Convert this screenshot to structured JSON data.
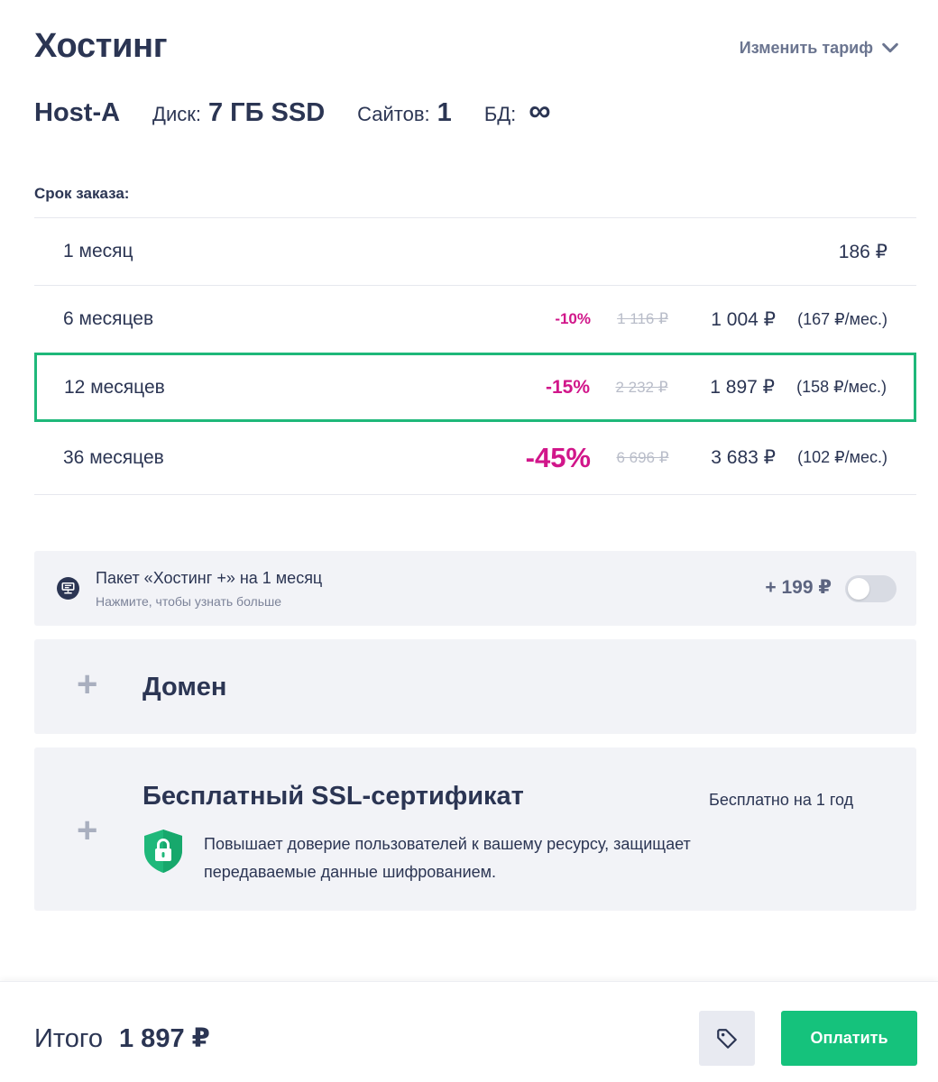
{
  "header": {
    "title": "Хостинг",
    "change_tariff": "Изменить тариф"
  },
  "plan": {
    "name": "Host-A",
    "disk_label": "Диск:",
    "disk_value": "7 ГБ SSD",
    "sites_label": "Сайтов:",
    "sites_value": "1",
    "db_label": "БД:",
    "db_value": "∞"
  },
  "period": {
    "label": "Срок заказа:",
    "options": [
      {
        "name": "1 месяц",
        "discount": "",
        "old_price": "",
        "price": "186 ₽",
        "per_month": ""
      },
      {
        "name": "6 месяцев",
        "discount": "-10%",
        "old_price": "1 116 ₽",
        "price": "1 004 ₽",
        "per_month": "(167 ₽/мес.)"
      },
      {
        "name": "12 месяцев",
        "discount": "-15%",
        "old_price": "2 232 ₽",
        "price": "1 897 ₽",
        "per_month": "(158 ₽/мес.)",
        "selected": true
      },
      {
        "name": "36 месяцев",
        "discount": "-45%",
        "old_price": "6 696 ₽",
        "price": "3 683 ₽",
        "per_month": "(102 ₽/мес.)"
      }
    ]
  },
  "addon": {
    "title": "Пакет «Хостинг +» на 1 месяц",
    "subtitle": "Нажмите, чтобы узнать больше",
    "price": "+ 199 ₽",
    "enabled": false
  },
  "domain": {
    "title": "Домен"
  },
  "ssl": {
    "title": "Бесплатный SSL-сертификат",
    "free_label": "Бесплатно на 1 год",
    "description": "Повышает доверие пользователей к вашему ресурсу, защищает передаваемые данные шифрованием."
  },
  "footer": {
    "total_label": "Итого",
    "total_value": "1 897 ₽",
    "pay_label": "Оплатить"
  },
  "colors": {
    "accent_green": "#15c27c",
    "discount_pink": "#d1168a",
    "text_dark": "#2b3553"
  }
}
